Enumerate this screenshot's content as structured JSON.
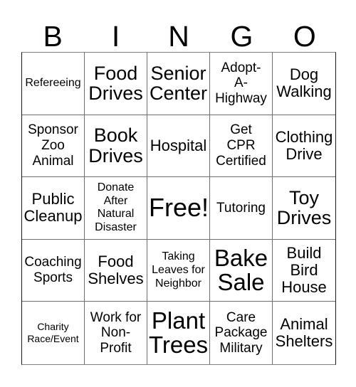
{
  "card": {
    "title": "Bingo Card",
    "background_color": "#ffffff",
    "text_color": "#000000",
    "border_color": "#6e6e6e",
    "columns": 5,
    "rows": 5
  },
  "header": {
    "letters": [
      {
        "label": "B"
      },
      {
        "label": "I"
      },
      {
        "label": "N"
      },
      {
        "label": "G"
      },
      {
        "label": "O"
      }
    ]
  },
  "grid": {
    "rows": [
      {
        "cells": [
          {
            "text": "Refereeing",
            "size": "s",
            "free": false
          },
          {
            "text": "Food\nDrives",
            "size": "xl",
            "free": false
          },
          {
            "text": "Senior\nCenter",
            "size": "xl",
            "free": false
          },
          {
            "text": "Adopt-\nA-\nHighway",
            "size": "m",
            "free": false
          },
          {
            "text": "Dog\nWalking",
            "size": "l",
            "free": false
          }
        ]
      },
      {
        "cells": [
          {
            "text": "Sponsor\nZoo\nAnimal",
            "size": "m",
            "free": false
          },
          {
            "text": "Book\nDrives",
            "size": "xl",
            "free": false
          },
          {
            "text": "Hospital",
            "size": "l",
            "free": false
          },
          {
            "text": "Get\nCPR\nCertified",
            "size": "m",
            "free": false
          },
          {
            "text": "Clothing\nDrive",
            "size": "l",
            "free": false
          }
        ]
      },
      {
        "cells": [
          {
            "text": "Public\nCleanup",
            "size": "l",
            "free": false
          },
          {
            "text": "Donate\nAfter\nNatural\nDisaster",
            "size": "s",
            "free": false
          },
          {
            "text": "Free!",
            "size": "huge",
            "free": true
          },
          {
            "text": "Tutoring",
            "size": "m",
            "free": false
          },
          {
            "text": "Toy\nDrives",
            "size": "xl",
            "free": false
          }
        ]
      },
      {
        "cells": [
          {
            "text": "Coaching\nSports",
            "size": "m",
            "free": false
          },
          {
            "text": "Food\nShelves",
            "size": "l",
            "free": false
          },
          {
            "text": "Taking\nLeaves for\nNeighbor",
            "size": "s",
            "free": false
          },
          {
            "text": "Bake\nSale",
            "size": "xxl",
            "free": false
          },
          {
            "text": "Build\nBird\nHouse",
            "size": "l",
            "free": false
          }
        ]
      },
      {
        "cells": [
          {
            "text": "Charity\nRace/Event",
            "size": "xs",
            "free": false
          },
          {
            "text": "Work for\nNon-\nProfit",
            "size": "m",
            "free": false
          },
          {
            "text": "Plant\nTrees",
            "size": "xxl",
            "free": false
          },
          {
            "text": "Care\nPackage\nMilitary",
            "size": "m",
            "free": false
          },
          {
            "text": "Animal\nShelters",
            "size": "l",
            "free": false
          }
        ]
      }
    ]
  }
}
